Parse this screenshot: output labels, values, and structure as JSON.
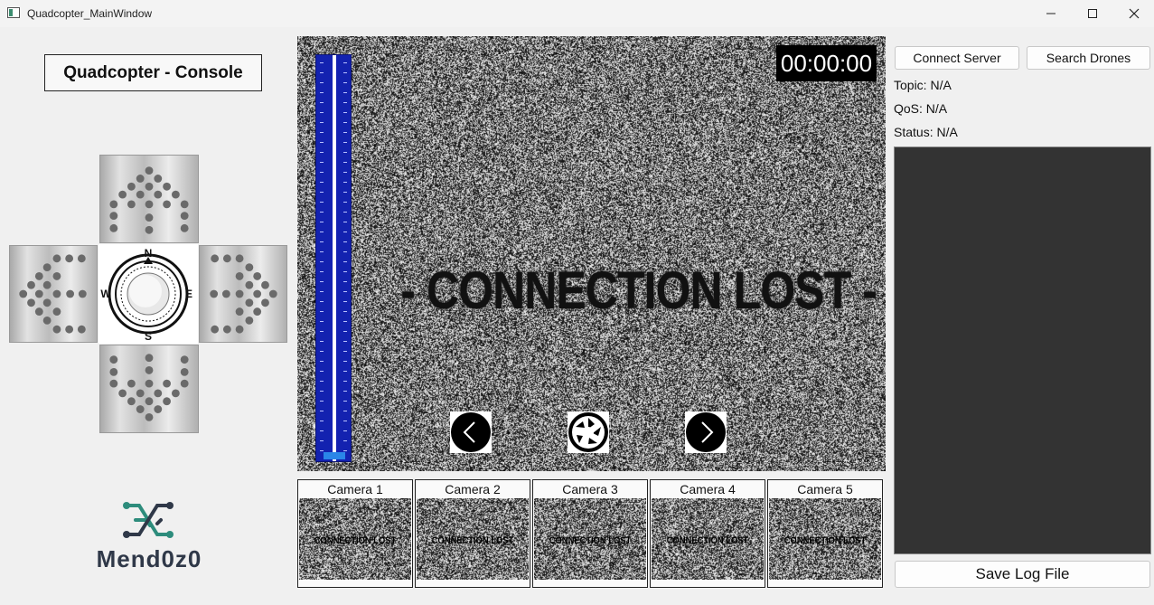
{
  "window": {
    "title": "Quadcopter_MainWindow"
  },
  "left": {
    "console_title": "Quadcopter - Console",
    "compass": {
      "n": "N",
      "s": "S",
      "e": "E",
      "w": "W"
    },
    "logo_text": "Mend0z0"
  },
  "video": {
    "timer": "00:00:00",
    "overlay": "- CONNECTION LOST -",
    "throttle_level": 0
  },
  "cameras": [
    {
      "label": "Camera 1",
      "overlay": "CONNECTION LOST"
    },
    {
      "label": "Camera 2",
      "overlay": "CONNECTION LOST"
    },
    {
      "label": "Camera 3",
      "overlay": "CONNECTION LOST"
    },
    {
      "label": "Camera 4",
      "overlay": "CONNECTION LOST"
    },
    {
      "label": "Camera 5",
      "overlay": "CONNECTION LOST"
    }
  ],
  "right": {
    "connect_label": "Connect Server",
    "search_label": "Search Drones",
    "topic": "Topic: N/A",
    "qos": "QoS: N/A",
    "status": "Status: N/A",
    "save_label": "Save Log File"
  },
  "colors": {
    "throttle": "#1322b0",
    "log_bg": "#333333"
  }
}
